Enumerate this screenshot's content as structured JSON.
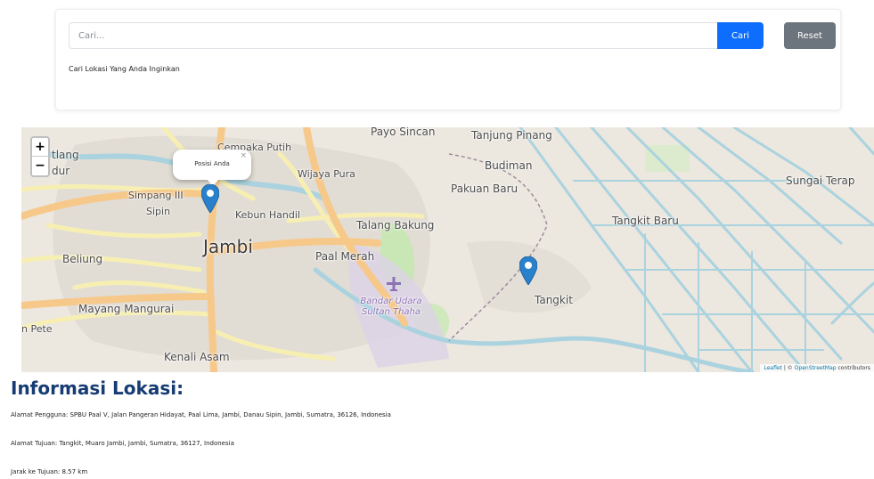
{
  "search": {
    "placeholder": "Cari...",
    "button_label": "Cari",
    "reset_label": "Reset",
    "hint": "Cari Lokasi Yang Anda Inginkan"
  },
  "map": {
    "zoom_in": "+",
    "zoom_out": "−",
    "popup_text": "Posisi Anda",
    "popup_close": "×",
    "labels": {
      "payo_sincan": "Payo Sincan",
      "tanjung_pinang": "Tanjung Pinang",
      "cempaka_putih": "Cempaka Putih",
      "wijaya_pura": "Wijaya Pura",
      "budiman": "Budiman",
      "pakuan_baru": "Pakuan Baru",
      "sungai_terap": "Sungai Terap",
      "simpang_iii": "Simpang III",
      "sipin": "Sipin",
      "kebun_handil": "Kebun Handil",
      "talang_bakung": "Talang Bakung",
      "tangkit_baru": "Tangkit Baru",
      "jambi": "Jambi",
      "paal_merah": "Paal Merah",
      "beliung": "Beliung",
      "tangkit": "Tangkit",
      "mayang_mangurai": "Mayang Mangurai",
      "kenali_asam": "Kenali Asam",
      "pete": "n Pete",
      "tlang": "tlang",
      "dur": "dur",
      "airport": "Bandar Udara Sultan Thaha"
    },
    "attribution": {
      "leaflet": "Leaflet",
      "separator": " | © ",
      "osm": "OpenStreetMap",
      "suffix": " contributors"
    },
    "colors": {
      "land": "#ece7df",
      "major_road": "#f6c88a",
      "road": "#f7efb2",
      "river": "#aad3df",
      "park": "#c9e6b5",
      "marker": "#2a81cb"
    }
  },
  "info": {
    "title": "Informasi Lokasi:",
    "user_address": "Alamat Pengguna: SPBU Paal V, Jalan Pangeran Hidayat, Paal Lima, Jambi, Danau Sipin, Jambi, Sumatra, 36126, Indonesia",
    "destination_address": "Alamat Tujuan: Tangkit, Muaro Jambi, Jambi, Sumatra, 36127, Indonesia",
    "distance": "Jarak ke Tujuan: 8.57 km"
  }
}
